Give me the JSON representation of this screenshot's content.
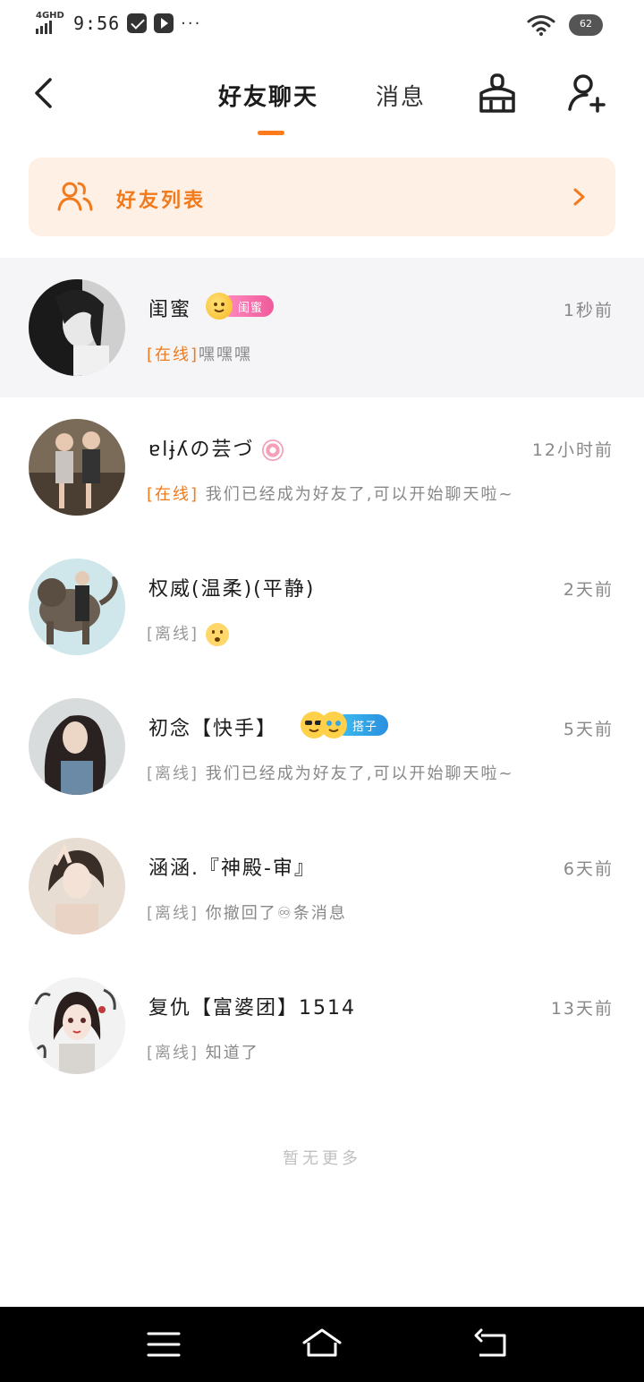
{
  "status_bar": {
    "network": "4GHD",
    "time": "9:56",
    "more": "···",
    "battery": "62"
  },
  "header": {
    "tab_friends": "好友聊天",
    "tab_messages": "消息"
  },
  "friend_list_banner": {
    "label": "好友列表"
  },
  "chats": [
    {
      "name": "闺蜜",
      "time": "1秒前",
      "status": "[在线]",
      "preview": "嘿嘿嘿",
      "badge": "闺蜜",
      "online": true
    },
    {
      "name": "ɐlɉʎの芸づ",
      "time": "12小时前",
      "status": "[在线]",
      "preview": "我们已经成为好友了,可以开始聊天啦~",
      "online": true
    },
    {
      "name": "权威(温柔)(平静)",
      "time": "2天前",
      "status": "[离线]",
      "preview": "",
      "online": false
    },
    {
      "name": "初念【快手】",
      "time": "5天前",
      "status": "[离线]",
      "preview": "我们已经成为好友了,可以开始聊天啦~",
      "badge": "搭子",
      "online": false
    },
    {
      "name": "涵涵.『神殿-审』",
      "time": "6天前",
      "status": "[离线]",
      "preview": "你撤回了♾条消息",
      "online": false
    },
    {
      "name": "复仇【富婆团】1514",
      "time": "13天前",
      "status": "[离线]",
      "preview": "知道了",
      "online": false
    }
  ],
  "footer": {
    "no_more": "暂无更多"
  },
  "colors": {
    "accent": "#f07a1c",
    "banner_bg": "#fff0e6",
    "badge_pink": "#f05a9a",
    "badge_blue": "#2a8fe0"
  }
}
